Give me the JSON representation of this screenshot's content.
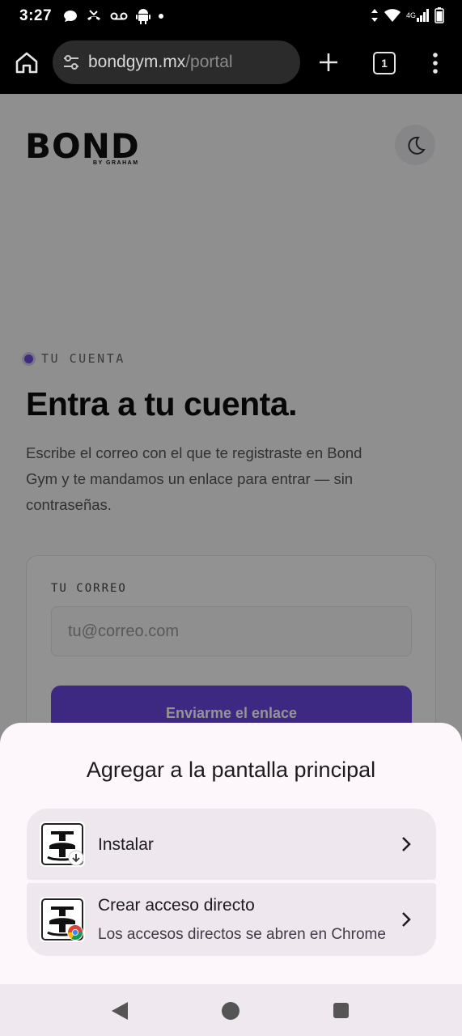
{
  "status_bar": {
    "time": "3:27",
    "left_icons": [
      "chat-bubble-icon",
      "missed-call-icon",
      "voicemail-icon",
      "android-icon",
      "dot-icon"
    ],
    "right_icons": [
      "data-transfer-icon",
      "wifi-icon",
      "4g-signal-icon",
      "battery-icon"
    ],
    "network_label": "4G"
  },
  "browser": {
    "url_host": "bondgym.mx",
    "url_path": "/portal",
    "tab_count": "1"
  },
  "page": {
    "logo_text": "BOND",
    "logo_sub": "BY GRAHAM",
    "eyebrow": "TU CUENTA",
    "headline": "Entra a tu cuenta.",
    "intro": "Escribe el correo con el que te registraste en Bond Gym y te mandamos un enlace para entrar — sin contraseñas.",
    "email_label": "TU CORREO",
    "email_placeholder": "tu@correo.com",
    "send_button": "Enviarme el enlace",
    "accent_color": "#6a45e0"
  },
  "sheet": {
    "title": "Agregar a la pantalla principal",
    "options": [
      {
        "label": "Instalar",
        "sublabel": ""
      },
      {
        "label": "Crear acceso directo",
        "sublabel": "Los accesos directos se abren en Chrome"
      }
    ]
  }
}
